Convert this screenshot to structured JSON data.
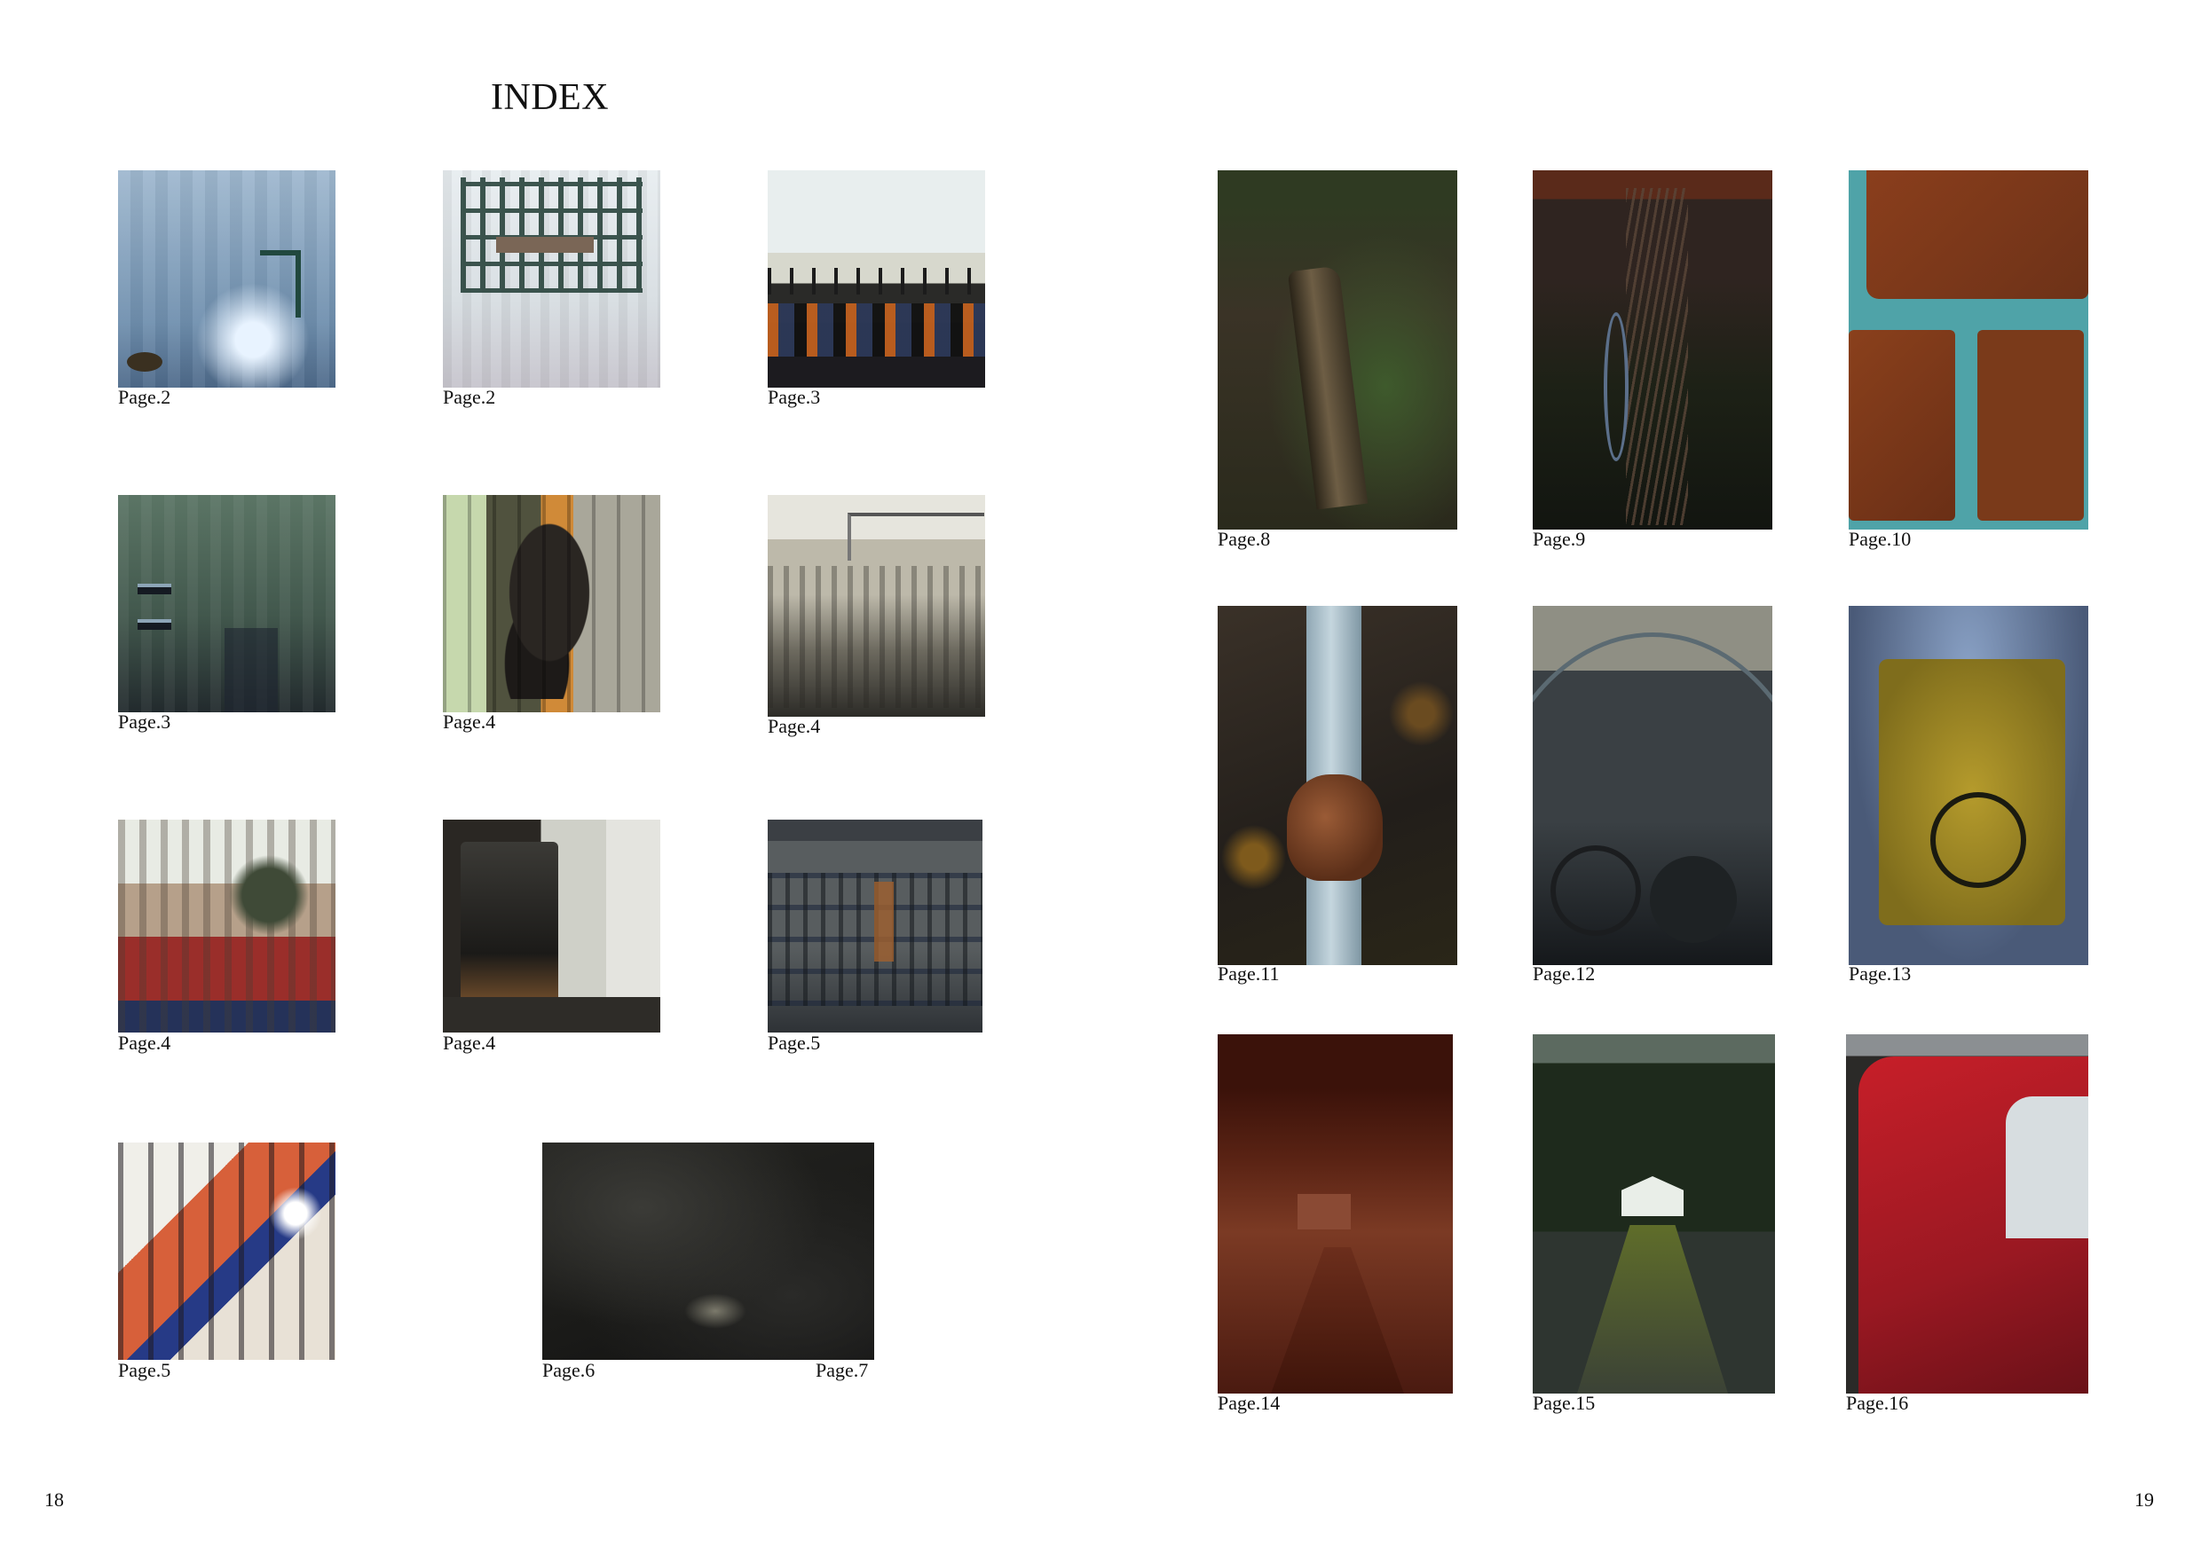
{
  "title": "INDEX",
  "left_page": {
    "folio": "18",
    "items": [
      {
        "caption": "Page.2"
      },
      {
        "caption": "Page.2"
      },
      {
        "caption": "Page.3"
      },
      {
        "caption": "Page.3"
      },
      {
        "caption": "Page.4"
      },
      {
        "caption": "Page.4"
      },
      {
        "caption": "Page.4"
      },
      {
        "caption": "Page.4"
      },
      {
        "caption": "Page.5"
      },
      {
        "caption": "Page.5"
      },
      {
        "caption": "Page.6",
        "caption_right": "Page.7"
      }
    ]
  },
  "right_page": {
    "folio": "19",
    "items": [
      {
        "caption": "Page.8"
      },
      {
        "caption": "Page.9"
      },
      {
        "caption": "Page.10"
      },
      {
        "caption": "Page.11"
      },
      {
        "caption": "Page.12"
      },
      {
        "caption": "Page.13"
      },
      {
        "caption": "Page.14"
      },
      {
        "caption": "Page.15"
      },
      {
        "caption": "Page.16"
      }
    ]
  }
}
